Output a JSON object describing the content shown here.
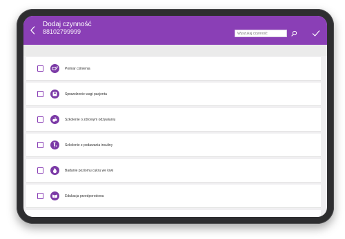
{
  "header": {
    "title": "Dodaj czynność",
    "subtitle": "88102799999"
  },
  "search": {
    "placeholder": "Wyszukaj czynność"
  },
  "colors": {
    "accent": "#8a3fb6",
    "icon_bg": "#7b3aa6",
    "device_frame": "#2e2e30",
    "background": "#f0eff1"
  },
  "activities": [
    {
      "label": "Pomiar ciśnienia",
      "icon": "blood-pressure-icon",
      "checked": false
    },
    {
      "label": "Sprawdzenie wagi pacjenta",
      "icon": "scale-icon",
      "checked": false
    },
    {
      "label": "Szkolenie o zdrowym odżywianiu",
      "icon": "nutrition-icon",
      "checked": false
    },
    {
      "label": "Szkolenie z podawania insuliny",
      "icon": "insulin-icon",
      "checked": false
    },
    {
      "label": "Badanie poziomu cukru we krwi",
      "icon": "blood-drop-icon",
      "checked": false
    },
    {
      "label": "Edukacja przedporodowa",
      "icon": "education-icon",
      "checked": false
    }
  ]
}
